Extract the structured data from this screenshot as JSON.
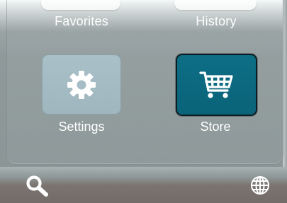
{
  "top_nav": {
    "favorites_label": "Favorites",
    "history_label": "History"
  },
  "tiles": {
    "settings": {
      "label": "Settings",
      "icon": "gear-icon"
    },
    "store": {
      "label": "Store",
      "icon": "shopping-cart-icon"
    }
  },
  "bottom_bar": {
    "left_icon": "search-icon",
    "right_icon": "globe-icon"
  },
  "colors": {
    "settings_tile": "#a6bdc5",
    "store_tile": "#0c6a80",
    "label_text": "#ffffff",
    "bottom_bar": "#766f6b"
  }
}
